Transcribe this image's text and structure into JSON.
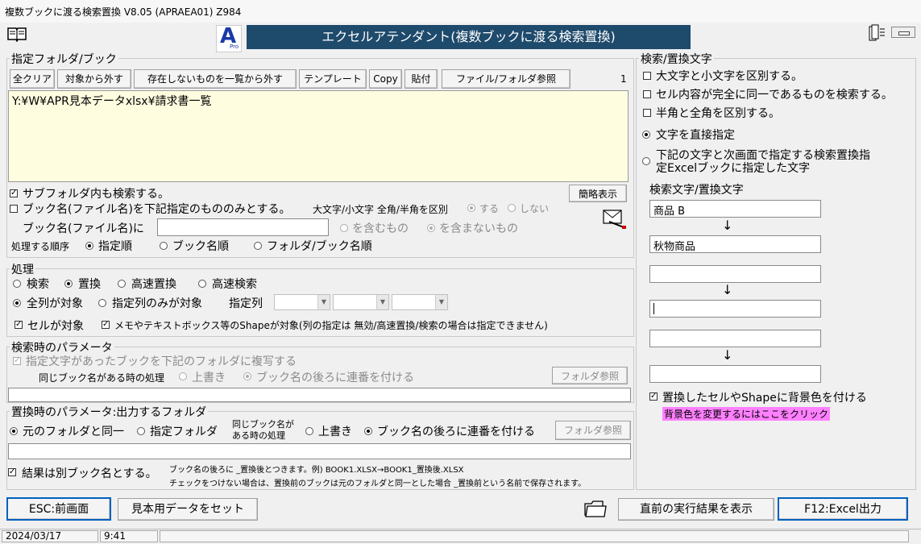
{
  "window": {
    "title": "複数ブックに渡る検索置換 V8.05 (APRAEA01)  Z984",
    "banner": "エクセルアテンダント(複数ブックに渡る検索置換)",
    "logo_letter": "A",
    "logo_sub": "Pro"
  },
  "colors": {
    "banner_bg": "#1e4a6c",
    "memo_bg": "#fffde0",
    "highlight_bg": "#ff80ff"
  },
  "folder_section": {
    "title": "指定フォルダ/ブック",
    "buttons": {
      "clear_all": "全クリア",
      "remove": "対象から外す",
      "remove_missing": "存在しないものを一覧から外す",
      "template": "テンプレート",
      "copy": "Copy",
      "paste": "貼付",
      "browse": "ファイル/フォルダ参照",
      "simple_view": "簡略表示"
    },
    "count": "1",
    "list_text": "Y:¥W¥APR見本データxlsx¥請求書一覧",
    "subfolder_label": "サブフォルダ内も検索する。",
    "bookname_filter_label": "ブック名(ファイル名)を下記指定のもののみとする。",
    "case_label": "大文字/小文字 全角/半角を区別",
    "case_yes": "する",
    "case_no": "しない",
    "bookname_prefix": "ブック名(ファイル名)に",
    "bookname_value": "",
    "contains": "を含むもの",
    "not_contains": "を含まないもの",
    "order_label": "処理する順序",
    "order_specified": "指定順",
    "order_bookname": "ブック名順",
    "order_folder_book": "フォルダ/ブック名順"
  },
  "process_section": {
    "title": "処理",
    "search": "検索",
    "replace": "置換",
    "fast_replace": "高速置換",
    "fast_search": "高速検索",
    "all_columns": "全列が対象",
    "specified_columns": "指定列のみが対象",
    "column_label": "指定列",
    "cells_label": "セルが対象",
    "shapes_label": "メモやテキストボックス等のShapeが対象(列の指定は 無効/高速置換/検索の場合は指定できません)"
  },
  "search_params": {
    "title": "検索時のパラメータ",
    "copy_label": "指定文字があったブックを下記のフォルダに複写する",
    "same_name_label": "同じブック名がある時の処理",
    "overwrite": "上書き",
    "add_number": "ブック名の後ろに連番を付ける",
    "folder_browse": "フォルダ参照",
    "folder_value": ""
  },
  "replace_params": {
    "title": "置換時のパラメータ:出力するフォルダ",
    "same_folder": "元のフォルダと同一",
    "specified_folder": "指定フォルダ",
    "same_name_line1": "同じブック名が",
    "same_name_line2": "ある時の処理",
    "overwrite": "上書き",
    "add_number": "ブック名の後ろに連番を付ける",
    "folder_browse": "フォルダ参照",
    "folder_value": "",
    "result_other_name": "結果は別ブック名とする。",
    "note_line1": "ブック名の後ろに _置換後とつきます。例) BOOK1.XLSX→BOOK1_置換後.XLSX",
    "note_line2": "チェックをつけない場合は、置換前のブックは元のフォルダと同一とした場合 _置換前という名前で保存されます。"
  },
  "search_text_section": {
    "title": "検索/置換文字",
    "case_sensitive": "大文字と小文字を区別する。",
    "exact_match": "セル内容が完全に同一であるものを検索する。",
    "width_sensitive": "半角と全角を区別する。",
    "direct": "文字を直接指定",
    "indirect_line1": "下記の文字と次画面で指定する検索置換指",
    "indirect_line2": "定Excelブックに指定した文字",
    "pairs_label": "検索文字/置換文字",
    "pairs": [
      {
        "search": "商品 B",
        "replace": "秋物商品"
      },
      {
        "search": "",
        "replace": ""
      },
      {
        "search": "",
        "replace": ""
      }
    ],
    "arrow": "↓",
    "bg_color_label": "置換したセルやShapeに背景色を付ける",
    "bg_color_link": "背景色を変更するにはここをクリック"
  },
  "bottom": {
    "esc": "ESC:前画面",
    "sample": "見本用データをセット",
    "last_result": "直前の実行結果を表示",
    "f12": "F12:Excel出力"
  },
  "status": {
    "date": "2024/03/17",
    "time": "9:41"
  }
}
